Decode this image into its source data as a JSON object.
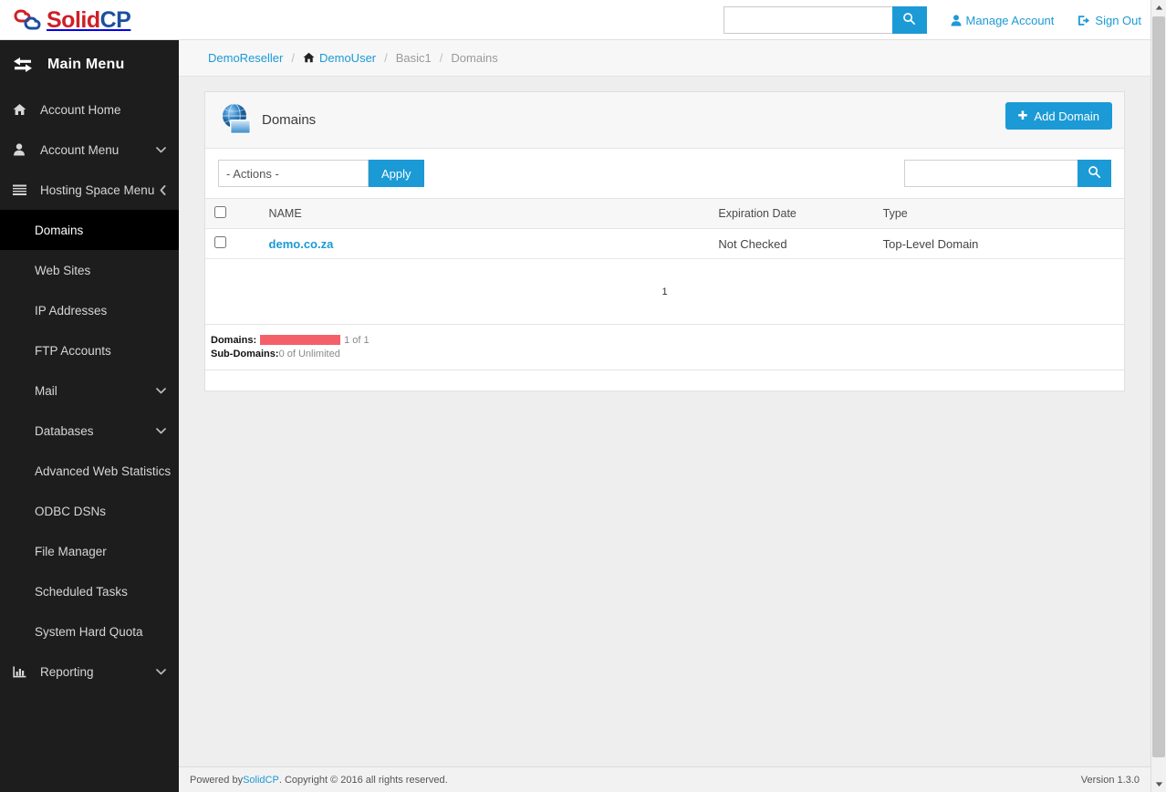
{
  "header": {
    "logo_solid": "Solid",
    "logo_cp": "CP",
    "logo_icon": "solidcp-cloud-logo",
    "search": {
      "value": "",
      "placeholder": "",
      "icon": "search-icon"
    },
    "manage_account": {
      "label": "Manage Account",
      "icon": "user-icon"
    },
    "sign_out": {
      "label": "Sign Out",
      "icon": "sign-out-icon"
    }
  },
  "sidebar": {
    "title": "Main Menu",
    "title_icon": "exchange-arrows-icon",
    "items": [
      {
        "label": "Account Home",
        "icon": "home-icon",
        "level": "top",
        "caret": "",
        "active": false
      },
      {
        "label": "Account Menu",
        "icon": "user-icon",
        "level": "top",
        "caret": "chevron-down-icon",
        "active": false
      },
      {
        "label": "Hosting Space Menu",
        "icon": "list-icon",
        "level": "top",
        "caret": "chevron-left-icon",
        "active": false
      },
      {
        "label": "Domains",
        "icon": "",
        "level": "sub",
        "caret": "",
        "active": true
      },
      {
        "label": "Web Sites",
        "icon": "",
        "level": "sub",
        "caret": "",
        "active": false
      },
      {
        "label": "IP Addresses",
        "icon": "",
        "level": "sub",
        "caret": "",
        "active": false
      },
      {
        "label": "FTP Accounts",
        "icon": "",
        "level": "sub",
        "caret": "",
        "active": false
      },
      {
        "label": "Mail",
        "icon": "",
        "level": "sub",
        "caret": "chevron-down-icon",
        "active": false
      },
      {
        "label": "Databases",
        "icon": "",
        "level": "sub",
        "caret": "chevron-down-icon",
        "active": false
      },
      {
        "label": "Advanced Web Statistics",
        "icon": "",
        "level": "sub",
        "caret": "",
        "active": false
      },
      {
        "label": "ODBC DSNs",
        "icon": "",
        "level": "sub",
        "caret": "",
        "active": false
      },
      {
        "label": "File Manager",
        "icon": "",
        "level": "sub",
        "caret": "",
        "active": false
      },
      {
        "label": "Scheduled Tasks",
        "icon": "",
        "level": "sub",
        "caret": "",
        "active": false
      },
      {
        "label": "System Hard Quota",
        "icon": "",
        "level": "sub",
        "caret": "",
        "active": false
      },
      {
        "label": "Reporting",
        "icon": "chart-bar-icon",
        "level": "top",
        "caret": "chevron-down-icon",
        "active": false
      }
    ]
  },
  "breadcrumb": {
    "separator": "/",
    "items": [
      {
        "label": "DemoReseller",
        "link": true,
        "icon": ""
      },
      {
        "label": "DemoUser",
        "link": true,
        "icon": "home-icon"
      },
      {
        "label": "Basic1",
        "link": false,
        "icon": ""
      },
      {
        "label": "Domains",
        "link": false,
        "icon": ""
      }
    ]
  },
  "panel": {
    "icon": "globe-window-icon",
    "title": "Domains",
    "add_button": {
      "label": "Add Domain",
      "icon": "plus-icon"
    },
    "toolbar": {
      "actions_selected": "- Actions -",
      "apply_label": "Apply",
      "search": {
        "value": "",
        "placeholder": "",
        "icon": "search-icon"
      }
    },
    "grid": {
      "columns": [
        "",
        "NAME",
        "Expiration Date",
        "Type"
      ],
      "header_checkbox_checked": false,
      "rows": [
        {
          "checked": false,
          "name": "demo.co.za",
          "expiration_date": "Not Checked",
          "type": "Top-Level Domain"
        }
      ]
    },
    "pager": {
      "current_page": "1"
    },
    "quota": [
      {
        "label": "Domains:",
        "has_bar": true,
        "percent": 100,
        "value": "1 of 1"
      },
      {
        "label": "Sub-Domains:",
        "has_bar": false,
        "percent": 0,
        "value": "0 of Unlimited"
      }
    ]
  },
  "footer": {
    "powered_prefix": "Powered by ",
    "powered_link": "SolidCP",
    "powered_suffix": ". Copyright © 2016 all rights reserved.",
    "version": "Version 1.3.0"
  },
  "colors": {
    "accent": "#1b9ad6",
    "sidebar_bg": "#1d1d1d",
    "sidebar_active_bg": "#000000",
    "quota_bar": "#f4606a",
    "logo_red": "#cf1f26",
    "logo_blue": "#1b4fa0"
  }
}
